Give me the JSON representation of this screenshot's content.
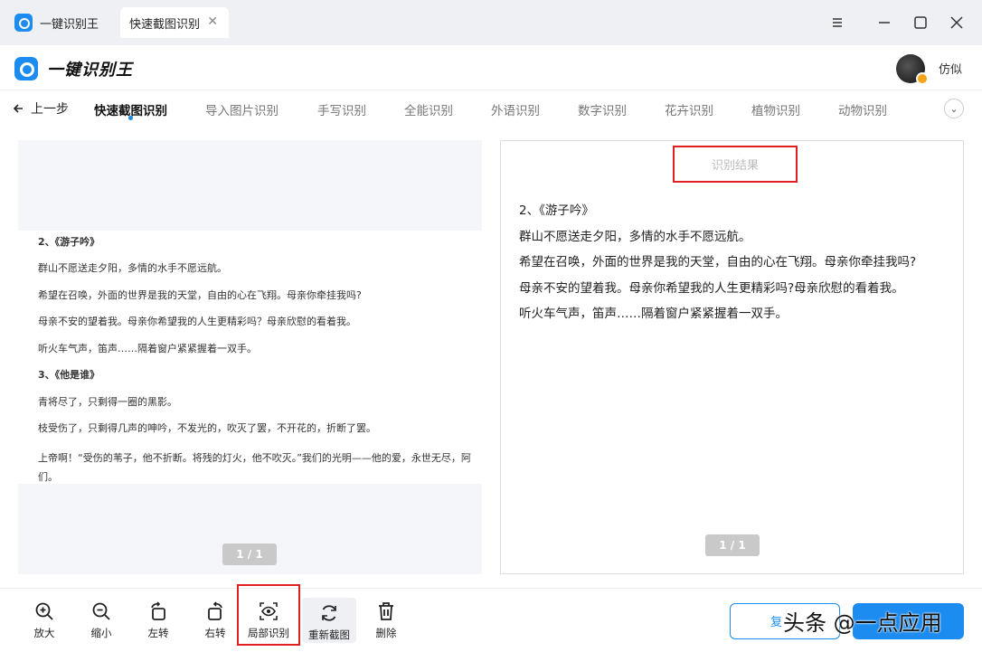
{
  "titlebar": {
    "app_tab": "一键识别王",
    "active_tab": "快速截图识别",
    "close_glyph": "✕"
  },
  "header": {
    "brand": "一键识别王",
    "user_name": "仿似"
  },
  "nav": {
    "back_label": "上一步",
    "items": [
      "快速截图识别",
      "导入图片识别",
      "手写识别",
      "全能识别",
      "外语识别",
      "数字识别",
      "花卉识别",
      "植物识别",
      "动物识别"
    ],
    "more_glyph": "⌄"
  },
  "document": {
    "lines": [
      "2、《游子吟》",
      "群山不愿送走夕阳，多情的水手不愿远航。",
      "希望在召唤，外面的世界是我的天堂，自由的心在飞翔。母亲你牵挂我吗?",
      "母亲不安的望着我。母亲你希望我的人生更精彩吗？母亲欣慰的看着我。",
      "听火车气声，笛声……隔着窗户紧紧握着一双手。",
      "3、《他是谁》",
      "青将尽了，只剩得一圈的黑影。",
      "枝受伤了，只剩得几声的呻吟，不发光的，吹灭了罢，不开花的，折断了罢。",
      "上帝啊！“受伤的苇子，他不折断。将残的灯火，他不吹灭。”我们的光明——他的爱，永世无尽，阿们。"
    ],
    "pager": "1 / 1"
  },
  "result": {
    "title": "识别结果",
    "lines": [
      "2、《游子吟》",
      "群山不愿送走夕阳，多情的水手不愿远航。",
      "希望在召唤，外面的世界是我的天堂，自由的心在飞翔。母亲你牵挂我吗?",
      "母亲不安的望着我。母亲你希望我的人生更精彩吗?母亲欣慰的看着我。",
      "听火车气声，笛声……隔着窗户紧紧握着一双手。"
    ],
    "pager": "1 / 1"
  },
  "toolbar": {
    "zoom_in": "放大",
    "zoom_out": "缩小",
    "rotate_left": "左转",
    "rotate_right": "右转",
    "partial_ocr": "局部识别",
    "recapture": "重新截图",
    "delete": "删除",
    "copy": "复",
    "watermark": "头条 @一点应用"
  },
  "colors": {
    "accent": "#1d8cf0",
    "highlight_border": "#e02020",
    "vip": "#f7a21b"
  }
}
